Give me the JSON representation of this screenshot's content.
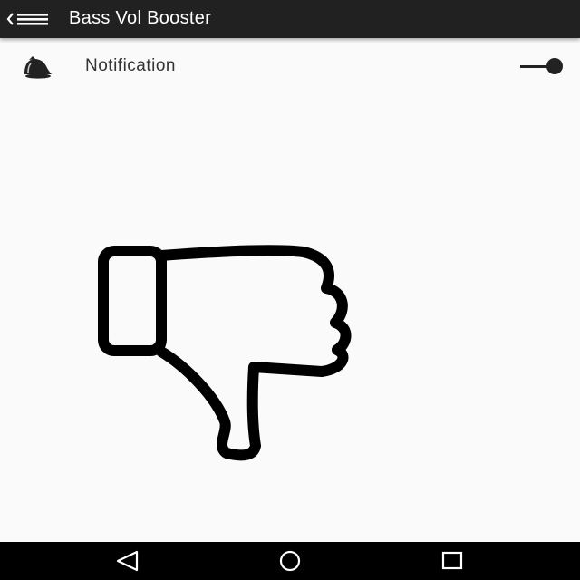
{
  "app_bar": {
    "title": "Bass Vol Booster",
    "nav_icon": "back-menu-icon",
    "background": "#212121"
  },
  "settings": {
    "notification": {
      "label": "Notification",
      "icon": "bell-icon",
      "toggle_state": "on"
    }
  },
  "main": {
    "graphic": "thumbs-down-icon"
  },
  "system_nav": {
    "back_icon": "back-triangle-icon",
    "home_icon": "home-circle-icon",
    "recents_icon": "recents-square-icon"
  }
}
